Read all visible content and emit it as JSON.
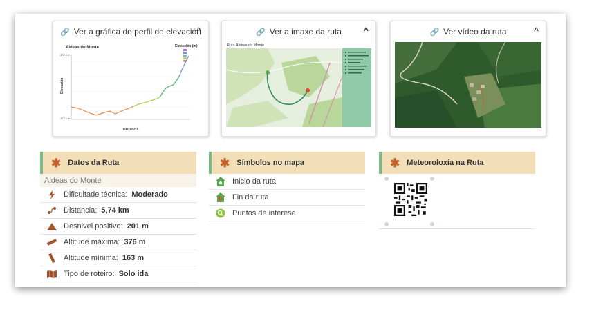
{
  "cards": {
    "elevation": {
      "title": "Ver a gráfica do perfil de elevación",
      "chart_heading": "Aldeas do Monte",
      "legend_title": "Elevación (m)",
      "y_title": "Elevación",
      "x_title": "Distancia",
      "y_top": "372.8 m",
      "y_bottom": "172.6 m"
    },
    "map": {
      "title": "Ver a imaxe da ruta",
      "map_heading": "Ruta Aldeas do Monte"
    },
    "video": {
      "title": "Ver vídeo da ruta"
    }
  },
  "route_data": {
    "title": "Datos da Ruta",
    "subtitle": "Aldeas do Monte",
    "rows": [
      {
        "label": "Dificultade técnica:",
        "value": "Moderado",
        "icon": "lightning-icon"
      },
      {
        "label": "Distancia:",
        "value": "5,74 km",
        "icon": "distance-icon"
      },
      {
        "label": "Desnivel positivo:",
        "value": "201 m",
        "icon": "mountain-icon"
      },
      {
        "label": "Altitude máxima:",
        "value": "376 m",
        "icon": "ruler-up-icon"
      },
      {
        "label": "Altitude mínima:",
        "value": "163 m",
        "icon": "ruler-down-icon"
      },
      {
        "label": "Tipo de roteiro:",
        "value": "Solo ida",
        "icon": "map-icon"
      }
    ]
  },
  "symbols": {
    "title": "Símbolos no mapa",
    "items": [
      {
        "label": "Inicio da ruta",
        "icon": "start-marker-icon",
        "color": "#5aa552"
      },
      {
        "label": "Fin da ruta",
        "icon": "end-marker-icon",
        "color": "#d9502e"
      },
      {
        "label": "Puntos de interese",
        "icon": "poi-marker-icon",
        "color": "#8fc23f"
      }
    ]
  },
  "weather": {
    "title": "Meteoroloxía na Ruta"
  },
  "colors": {
    "accent": "#c0612b",
    "header_bg": "#f2dfb8",
    "header_border": "#7cb98a"
  }
}
